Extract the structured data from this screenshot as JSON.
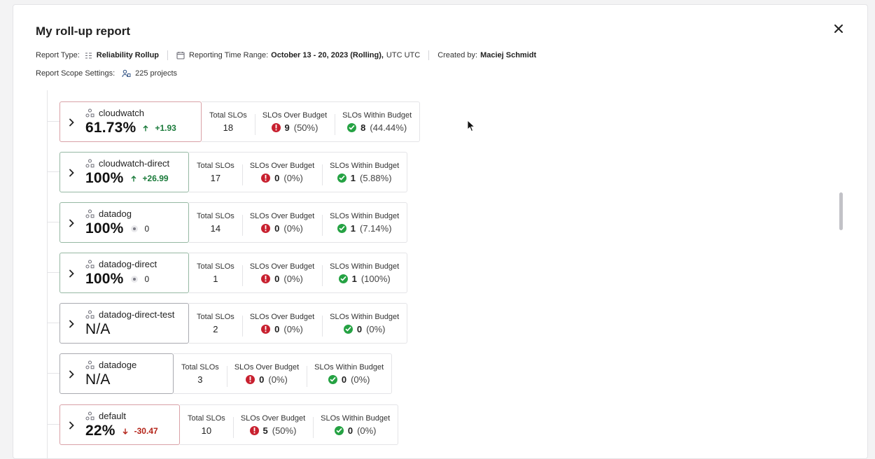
{
  "modal": {
    "title": "My roll-up report",
    "report_type_label": "Report Type:",
    "report_type_value": "Reliability Rollup",
    "time_range_label": "Reporting Time Range:",
    "time_range_value": "October 13 - 20, 2023 (Rolling),",
    "time_zone": "UTC UTC",
    "created_by_label": "Created by:",
    "created_by_value": "Maciej Schmidt",
    "scope_label": "Report Scope Settings:",
    "scope_value": "225 projects"
  },
  "stat_labels": {
    "total": "Total SLOs",
    "over": "SLOs Over Budget",
    "within": "SLOs Within Budget"
  },
  "rows": [
    {
      "name": "cloudwatch",
      "percent": "61.73%",
      "delta": "+1.93",
      "trend": "up",
      "status": "red",
      "total": "18",
      "over": "9",
      "over_pct": "(50%)",
      "within": "8",
      "within_pct": "(44.44%)"
    },
    {
      "name": "cloudwatch-direct",
      "percent": "100%",
      "delta": "+26.99",
      "trend": "up",
      "status": "green",
      "total": "17",
      "over": "0",
      "over_pct": "(0%)",
      "within": "1",
      "within_pct": "(5.88%)"
    },
    {
      "name": "datadog",
      "percent": "100%",
      "delta": "0",
      "trend": "neutral",
      "status": "green",
      "total": "14",
      "over": "0",
      "over_pct": "(0%)",
      "within": "1",
      "within_pct": "(7.14%)"
    },
    {
      "name": "datadog-direct",
      "percent": "100%",
      "delta": "0",
      "trend": "neutral",
      "status": "green",
      "total": "1",
      "over": "0",
      "over_pct": "(0%)",
      "within": "1",
      "within_pct": "(100%)"
    },
    {
      "name": "datadog-direct-test",
      "percent": "N/A",
      "delta": "",
      "trend": "none",
      "status": "gray",
      "total": "2",
      "over": "0",
      "over_pct": "(0%)",
      "within": "0",
      "within_pct": "(0%)"
    },
    {
      "name": "datadoge",
      "percent": "N/A",
      "delta": "",
      "trend": "none",
      "status": "gray",
      "total": "3",
      "over": "0",
      "over_pct": "(0%)",
      "within": "0",
      "within_pct": "(0%)"
    },
    {
      "name": "default",
      "percent": "22%",
      "delta": "-30.47",
      "trend": "down",
      "status": "red",
      "total": "10",
      "over": "5",
      "over_pct": "(50%)",
      "within": "0",
      "within_pct": "(0%)"
    }
  ]
}
